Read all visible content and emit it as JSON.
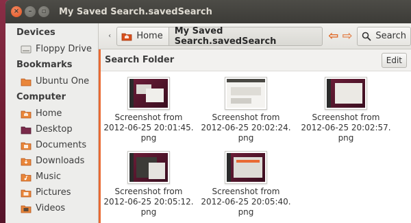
{
  "window": {
    "title": "My Saved Search.savedSearch",
    "close_glyph": "×",
    "min_glyph": "–",
    "max_glyph": "▫"
  },
  "sidebar": {
    "sections": [
      {
        "heading": "Devices",
        "items": [
          {
            "label": "Floppy Drive",
            "icon": "floppy-drive-icon"
          }
        ]
      },
      {
        "heading": "Bookmarks",
        "items": [
          {
            "label": "Ubuntu One",
            "icon": "folder-icon"
          }
        ]
      },
      {
        "heading": "Computer",
        "items": [
          {
            "label": "Home",
            "icon": "home-folder-icon"
          },
          {
            "label": "Desktop",
            "icon": "desktop-folder-icon"
          },
          {
            "label": "Documents",
            "icon": "documents-folder-icon"
          },
          {
            "label": "Downloads",
            "icon": "downloads-folder-icon"
          },
          {
            "label": "Music",
            "icon": "music-folder-icon"
          },
          {
            "label": "Pictures",
            "icon": "pictures-folder-icon"
          },
          {
            "label": "Videos",
            "icon": "videos-folder-icon"
          }
        ]
      }
    ]
  },
  "toolbar": {
    "path_left_glyph": "‹",
    "home_label": "Home",
    "current_label": "My Saved Search.savedSearch",
    "back_glyph": "⇦",
    "forward_glyph": "⇨",
    "search_label": "Search"
  },
  "content": {
    "folder_title": "Search Folder",
    "edit_label": "Edit",
    "files": [
      {
        "line1": "Screenshot from",
        "line2": "2012-06-25 20:01:45.",
        "line3": "png",
        "variant": "dark"
      },
      {
        "line1": "Screenshot from",
        "line2": "2012-06-25 20:02:24.",
        "line3": "png",
        "variant": "light"
      },
      {
        "line1": "Screenshot from",
        "line2": "2012-06-25 20:02:57.",
        "line3": "png",
        "variant": "dark"
      },
      {
        "line1": "Screenshot from",
        "line2": "2012-06-25 20:05:12.",
        "line3": "png",
        "variant": "dark"
      },
      {
        "line1": "Screenshot from",
        "line2": "2012-06-25 20:05:40.",
        "line3": "png",
        "variant": "dark"
      }
    ]
  },
  "colors": {
    "accent_orange": "#e96a33",
    "titlebar": "#3c3b37",
    "sidebar_bg": "#ededeb",
    "wallpaper": "#7a1f35"
  }
}
